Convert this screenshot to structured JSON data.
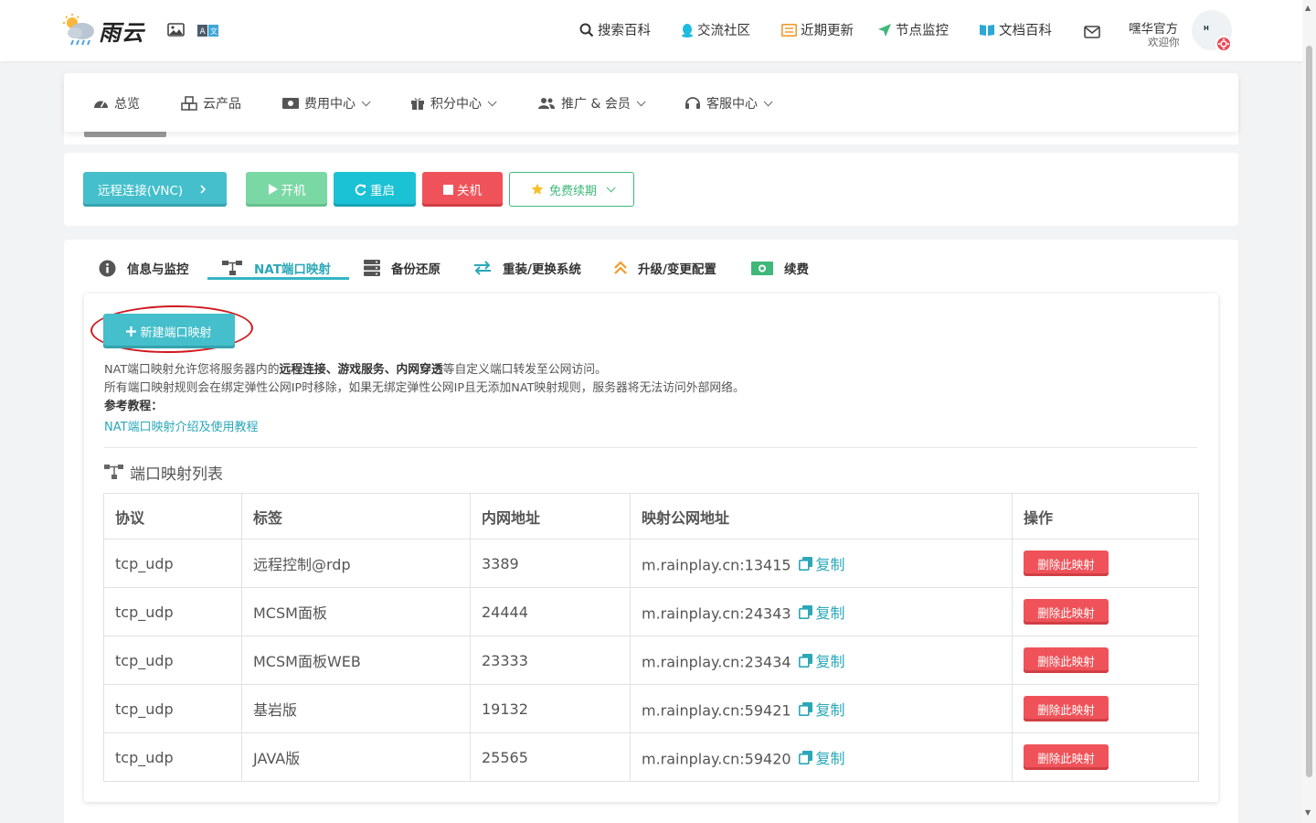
{
  "header": {
    "logo_text": "雨云",
    "nav": [
      "搜索百科",
      "交流社区",
      "近期更新",
      "节点监控",
      "文档百科"
    ],
    "user_name": "嘿华官方",
    "user_greeting": "欢迎你",
    "avatar_text": "H"
  },
  "subnav": [
    "总览",
    "云产品",
    "费用中心",
    "积分中心",
    "推广 & 会员",
    "客服中心"
  ],
  "actions": {
    "vnc": "远程连接(VNC)",
    "start": "开机",
    "restart": "重启",
    "shutdown": "关机",
    "renew": "免费续期"
  },
  "tabs": [
    "信息与监控",
    "NAT端口映射",
    "备份还原",
    "重装/更换系统",
    "升级/变更配置",
    "续费"
  ],
  "active_tab": "NAT端口映射",
  "nat": {
    "new_button": "新建端口映射",
    "desc_1_pre": "NAT端口映射允许您将服务器内的",
    "desc_1_bold": "远程连接、游戏服务、内网穿透",
    "desc_1_post": "等自定义端口转发至公网访问。",
    "desc_2": "所有端口映射规则会在绑定弹性公网IP时移除，如果无绑定弹性公网IP且无添加NAT映射规则，服务器将无法访问外部网络。",
    "ref_label": "参考教程：",
    "ref_link": "NAT端口映射介绍及使用教程",
    "list_title": "端口映射列表",
    "columns": [
      "协议",
      "标签",
      "内网地址",
      "映射公网地址",
      "操作"
    ],
    "rows": [
      {
        "protocol": "tcp_udp",
        "label": "远程控制@rdp",
        "internal": "3389",
        "public": "m.rainplay.cn:13415"
      },
      {
        "protocol": "tcp_udp",
        "label": "MCSM面板",
        "internal": "24444",
        "public": "m.rainplay.cn:24343"
      },
      {
        "protocol": "tcp_udp",
        "label": "MCSM面板WEB",
        "internal": "23333",
        "public": "m.rainplay.cn:23434"
      },
      {
        "protocol": "tcp_udp",
        "label": "基岩版",
        "internal": "19132",
        "public": "m.rainplay.cn:59421"
      },
      {
        "protocol": "tcp_udp",
        "label": "JAVA版",
        "internal": "25565",
        "public": "m.rainplay.cn:59420"
      }
    ],
    "copy_label": "复制",
    "delete_label": "删除此映射"
  },
  "colors": {
    "accent": "#44bfcb",
    "danger": "#ef5359",
    "success": "#3fb87a",
    "highlight_circle": "#d0191f"
  }
}
